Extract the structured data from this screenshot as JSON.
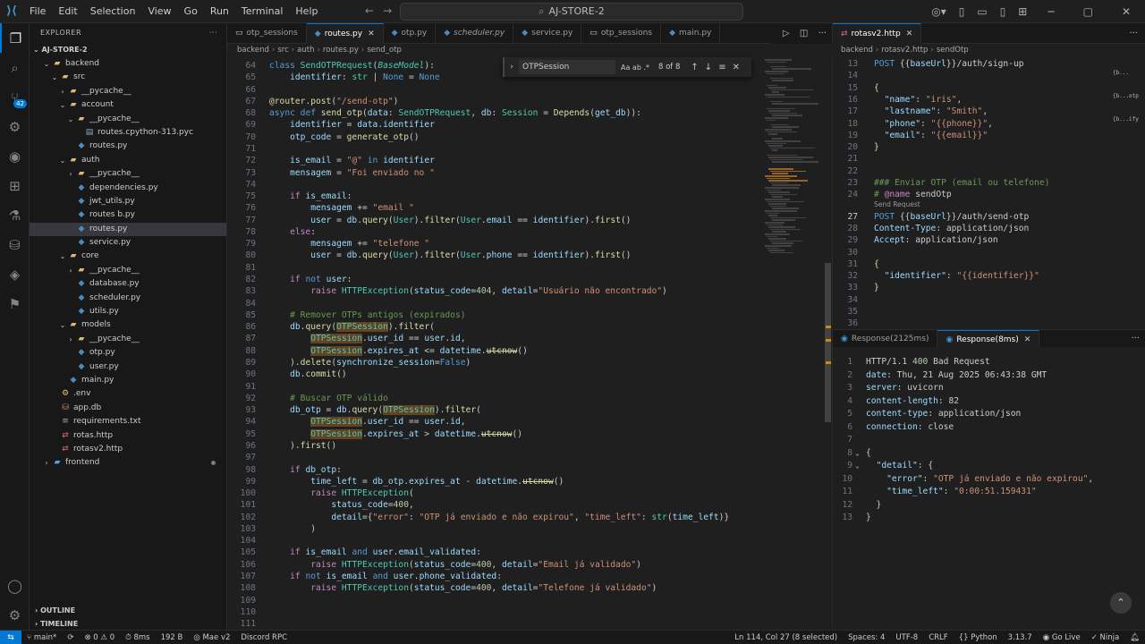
{
  "titlebar": {
    "menu": [
      "File",
      "Edit",
      "Selection",
      "View",
      "Go",
      "Run",
      "Terminal",
      "Help"
    ],
    "search_text": "AJ-STORE-2"
  },
  "activity": {
    "scm_badge": "42"
  },
  "sidebar": {
    "title": "EXPLORER",
    "root": "AJ-STORE-2",
    "tree": [
      {
        "label": "backend",
        "depth": 0,
        "kind": "folder",
        "open": true
      },
      {
        "label": "src",
        "depth": 1,
        "kind": "folder",
        "open": true
      },
      {
        "label": "__pycache__",
        "depth": 2,
        "kind": "folder",
        "open": false
      },
      {
        "label": "account",
        "depth": 2,
        "kind": "folder",
        "open": true
      },
      {
        "label": "__pycache__",
        "depth": 3,
        "kind": "folder",
        "open": true
      },
      {
        "label": "routes.cpython-313.pyc",
        "depth": 4,
        "kind": "file"
      },
      {
        "label": "routes.py",
        "depth": 3,
        "kind": "py"
      },
      {
        "label": "auth",
        "depth": 2,
        "kind": "folder",
        "open": true
      },
      {
        "label": "__pycache__",
        "depth": 3,
        "kind": "folder",
        "open": false
      },
      {
        "label": "dependencies.py",
        "depth": 3,
        "kind": "py"
      },
      {
        "label": "jwt_utils.py",
        "depth": 3,
        "kind": "py"
      },
      {
        "label": "routes b.py",
        "depth": 3,
        "kind": "py"
      },
      {
        "label": "routes.py",
        "depth": 3,
        "kind": "py",
        "selected": true
      },
      {
        "label": "service.py",
        "depth": 3,
        "kind": "py"
      },
      {
        "label": "core",
        "depth": 2,
        "kind": "folder",
        "open": true
      },
      {
        "label": "__pycache__",
        "depth": 3,
        "kind": "folder",
        "open": false
      },
      {
        "label": "database.py",
        "depth": 3,
        "kind": "py"
      },
      {
        "label": "scheduler.py",
        "depth": 3,
        "kind": "py"
      },
      {
        "label": "utils.py",
        "depth": 3,
        "kind": "py"
      },
      {
        "label": "models",
        "depth": 2,
        "kind": "folder",
        "open": true
      },
      {
        "label": "__pycache__",
        "depth": 3,
        "kind": "folder",
        "open": false
      },
      {
        "label": "otp.py",
        "depth": 3,
        "kind": "py"
      },
      {
        "label": "user.py",
        "depth": 3,
        "kind": "py"
      },
      {
        "label": "main.py",
        "depth": 2,
        "kind": "py"
      },
      {
        "label": ".env",
        "depth": 1,
        "kind": "env"
      },
      {
        "label": "app.db",
        "depth": 1,
        "kind": "db"
      },
      {
        "label": "requirements.txt",
        "depth": 1,
        "kind": "txt"
      },
      {
        "label": "rotas.http",
        "depth": 1,
        "kind": "http"
      },
      {
        "label": "rotasv2.http",
        "depth": 1,
        "kind": "http"
      },
      {
        "label": "frontend",
        "depth": 0,
        "kind": "fe",
        "open": false,
        "modified": true
      }
    ],
    "outline": "OUTLINE",
    "timeline": "TIMELINE"
  },
  "editor1": {
    "tabs": [
      {
        "label": "otp_sessions",
        "icon": "sc"
      },
      {
        "label": "routes.py",
        "icon": "py",
        "active": true
      },
      {
        "label": "otp.py",
        "icon": "py"
      },
      {
        "label": "scheduler.py",
        "icon": "py",
        "italic": true
      },
      {
        "label": "service.py",
        "icon": "py"
      },
      {
        "label": "otp_sessions",
        "icon": "sc"
      },
      {
        "label": "main.py",
        "icon": "py"
      }
    ],
    "breadcrumb": [
      "backend",
      "src",
      "auth",
      "routes.py",
      "send_otp"
    ],
    "find": {
      "query": "OTPSession",
      "opts": "Aa  ab  .*",
      "count": "8 of 8"
    },
    "lines": [
      {
        "n": "64",
        "h": "<span class=\"k\">class</span> <span class=\"t\">SendOTPRequest</span>(<span class=\"t\" style=\"font-style:italic\">BaseModel</span>):"
      },
      {
        "n": "65",
        "h": "    <span class=\"v\">identifier</span>: <span class=\"t\">str</span> | <span class=\"k\">None</span> = <span class=\"k\">None</span>"
      },
      {
        "n": "66",
        "h": ""
      },
      {
        "n": "67",
        "h": "<span class=\"f\">@router</span>.<span class=\"f\">post</span>(<span class=\"s\">\"/send-otp\"</span>)"
      },
      {
        "n": "68",
        "h": "<span class=\"k\">async</span> <span class=\"k\">def</span> <span class=\"f\">send_otp</span>(<span class=\"v\">data</span>: <span class=\"t\">SendOTPRequest</span>, <span class=\"v\">db</span>: <span class=\"t\">Session</span> = <span class=\"f\">Depends</span>(<span class=\"v\">get_db</span>)):"
      },
      {
        "n": "69",
        "h": "    <span class=\"v\">identifier</span> = <span class=\"v\">data</span>.<span class=\"v\">identifier</span>"
      },
      {
        "n": "70",
        "h": "    <span class=\"v\">otp_code</span> = <span class=\"f\">generate_otp</span>()"
      },
      {
        "n": "71",
        "h": ""
      },
      {
        "n": "72",
        "h": "    <span class=\"v\">is_email</span> = <span class=\"s\">\"@\"</span> <span class=\"k\">in</span> <span class=\"v\">identifier</span>"
      },
      {
        "n": "73",
        "h": "    <span class=\"v\">mensagem</span> = <span class=\"s\">\"Foi enviado no \"</span>"
      },
      {
        "n": "74",
        "h": ""
      },
      {
        "n": "75",
        "h": "    <span class=\"kw\">if</span> <span class=\"v\">is_email</span>:"
      },
      {
        "n": "76",
        "h": "        <span class=\"v\">mensagem</span> += <span class=\"s\">\"email \"</span>"
      },
      {
        "n": "77",
        "h": "        <span class=\"v\">user</span> = <span class=\"v\">db</span>.<span class=\"f\">query</span>(<span class=\"t\">User</span>).<span class=\"f\">filter</span>(<span class=\"t\">User</span>.<span class=\"v\">email</span> == <span class=\"v\">identifier</span>).<span class=\"f\">first</span>()"
      },
      {
        "n": "78",
        "h": "    <span class=\"kw\">else</span>:"
      },
      {
        "n": "79",
        "h": "        <span class=\"v\">mensagem</span> += <span class=\"s\">\"telefone \"</span>"
      },
      {
        "n": "80",
        "h": "        <span class=\"v\">user</span> = <span class=\"v\">db</span>.<span class=\"f\">query</span>(<span class=\"t\">User</span>).<span class=\"f\">filter</span>(<span class=\"t\">User</span>.<span class=\"v\">phone</span> == <span class=\"v\">identifier</span>).<span class=\"f\">first</span>()"
      },
      {
        "n": "81",
        "h": ""
      },
      {
        "n": "82",
        "h": "    <span class=\"kw\">if</span> <span class=\"k\">not</span> <span class=\"v\">user</span>:"
      },
      {
        "n": "83",
        "h": "        <span class=\"kw\">raise</span> <span class=\"t\">HTTPException</span>(<span class=\"v\">status_code</span>=<span class=\"n\">404</span>, <span class=\"v\">detail</span>=<span class=\"s\">\"Usuário não encontrado\"</span>)"
      },
      {
        "n": "84",
        "h": ""
      },
      {
        "n": "85",
        "h": "    <span class=\"c\"># Remover OTPs antigos (expirados)</span>"
      },
      {
        "n": "86",
        "h": "    <span class=\"v\">db</span>.<span class=\"f\">query</span>(<span class=\"hl\">OTPSession</span>).<span class=\"f\">filter</span>("
      },
      {
        "n": "87",
        "h": "        <span class=\"hl\">OTPSession</span>.<span class=\"v\">user_id</span> == <span class=\"v\">user</span>.<span class=\"v\">id</span>,"
      },
      {
        "n": "88",
        "h": "        <span class=\"hl\">OTPSession</span>.<span class=\"v\">expires_at</span> <= <span class=\"v\">datetime</span>.<span class=\"f strike\">utcnow</span>()"
      },
      {
        "n": "89",
        "h": "    ).<span class=\"f\">delete</span>(<span class=\"v\">synchronize_session</span>=<span class=\"k\">False</span>)"
      },
      {
        "n": "90",
        "h": "    <span class=\"v\">db</span>.<span class=\"f\">commit</span>()"
      },
      {
        "n": "91",
        "h": ""
      },
      {
        "n": "92",
        "h": "    <span class=\"c\"># Buscar OTP válido</span>"
      },
      {
        "n": "93",
        "h": "    <span class=\"v\">db_otp</span> = <span class=\"v\">db</span>.<span class=\"f\">query</span>(<span class=\"hl\">OTPSession</span>).<span class=\"f\">filter</span>("
      },
      {
        "n": "94",
        "h": "        <span class=\"hl\">OTPSession</span>.<span class=\"v\">user_id</span> == <span class=\"v\">user</span>.<span class=\"v\">id</span>,"
      },
      {
        "n": "95",
        "h": "        <span class=\"hl\">OTPSession</span>.<span class=\"v\">expires_at</span> > <span class=\"v\">datetime</span>.<span class=\"f strike\">utcnow</span>()"
      },
      {
        "n": "96",
        "h": "    ).<span class=\"f\">first</span>()"
      },
      {
        "n": "97",
        "h": ""
      },
      {
        "n": "98",
        "h": "    <span class=\"kw\">if</span> <span class=\"v\">db_otp</span>:"
      },
      {
        "n": "99",
        "h": "        <span class=\"v\">time_left</span> = <span class=\"v\">db_otp</span>.<span class=\"v\">expires_at</span> - <span class=\"v\">datetime</span>.<span class=\"f strike\">utcnow</span>()"
      },
      {
        "n": "100",
        "h": "        <span class=\"kw\">raise</span> <span class=\"t\">HTTPException</span>("
      },
      {
        "n": "101",
        "h": "            <span class=\"v\">status_code</span>=<span class=\"n\">400</span>,"
      },
      {
        "n": "102",
        "h": "            <span class=\"v\">detail</span>={<span class=\"s\">\"error\"</span>: <span class=\"s\">\"OTP já enviado e não expirou\"</span>, <span class=\"s\">\"time_left\"</span>: <span class=\"t\">str</span>(<span class=\"v\">time_left</span>)}"
      },
      {
        "n": "103",
        "h": "        )"
      },
      {
        "n": "104",
        "h": ""
      },
      {
        "n": "105",
        "h": "    <span class=\"kw\">if</span> <span class=\"v\">is_email</span> <span class=\"k\">and</span> <span class=\"v\">user</span>.<span class=\"v\">email_validated</span>:"
      },
      {
        "n": "106",
        "h": "        <span class=\"kw\">raise</span> <span class=\"t\">HTTPException</span>(<span class=\"v\">status_code</span>=<span class=\"n\">400</span>, <span class=\"v\">detail</span>=<span class=\"s\">\"Email já validado\"</span>)"
      },
      {
        "n": "107",
        "h": "    <span class=\"kw\">if</span> <span class=\"k\">not</span> <span class=\"v\">is_email</span> <span class=\"k\">and</span> <span class=\"v\">user</span>.<span class=\"v\">phone_validated</span>:"
      },
      {
        "n": "108",
        "h": "        <span class=\"kw\">raise</span> <span class=\"t\">HTTPException</span>(<span class=\"v\">status_code</span>=<span class=\"n\">400</span>, <span class=\"v\">detail</span>=<span class=\"s\">\"Telefone já validado\"</span>)"
      },
      {
        "n": "109",
        "h": ""
      },
      {
        "n": "110",
        "h": ""
      },
      {
        "n": "111",
        "h": ""
      }
    ]
  },
  "editor2": {
    "tab": "rotasv2.http",
    "breadcrumb": [
      "backend",
      "rotasv2.http",
      "sendOtp"
    ],
    "codelens": "Send Request",
    "lines": [
      {
        "n": "13",
        "h": "<span class=\"hk\">POST</span> <span class=\"hj\">{{</span><span class=\"hv\">baseUrl</span><span class=\"hj\">}}/auth/sign-up</span>"
      },
      {
        "n": "14",
        "h": ""
      },
      {
        "n": "15",
        "h": "<span class=\"f\">{</span>"
      },
      {
        "n": "16",
        "h": "  <span class=\"hv\">\"name\"</span>: <span class=\"hs\">\"iris\"</span>,"
      },
      {
        "n": "17",
        "h": "  <span class=\"hv\">\"lastname\"</span>: <span class=\"hs\">\"Smith\"</span>,"
      },
      {
        "n": "18",
        "h": "  <span class=\"hv\">\"phone\"</span>: <span class=\"hs\">\"{{phone}}\"</span>,"
      },
      {
        "n": "19",
        "h": "  <span class=\"hv\">\"email\"</span>: <span class=\"hs\">\"{{email}}\"</span>"
      },
      {
        "n": "20",
        "h": "<span class=\"f\">}</span>"
      },
      {
        "n": "21",
        "h": ""
      },
      {
        "n": "22",
        "h": ""
      },
      {
        "n": "23",
        "h": "<span class=\"hc\">### Enviar OTP (email ou telefone)</span>"
      },
      {
        "n": "24",
        "h": "<span class=\"hc\"># </span><span class=\"hm\">@name</span> <span class=\"hj\">sendOtp</span>"
      },
      {
        "n": "27",
        "h": "<span class=\"hk\">POST</span> <span class=\"hj\">{{</span><span class=\"hv\">baseUrl</span><span class=\"hj\">}}/auth/send-otp</span>"
      },
      {
        "n": "28",
        "h": "<span class=\"hv\">Content-Type</span>: <span class=\"hj\">application/json</span>"
      },
      {
        "n": "29",
        "h": "<span class=\"hv\">Accept</span>: <span class=\"hj\">application/json</span>"
      },
      {
        "n": "30",
        "h": ""
      },
      {
        "n": "31",
        "h": "<span class=\"f\">{</span>"
      },
      {
        "n": "32",
        "h": "  <span class=\"hv\">\"identifier\"</span>: <span class=\"hs\">\"{{identifier}}\"</span>"
      },
      {
        "n": "33",
        "h": "<span class=\"f\">}</span>"
      },
      {
        "n": "34",
        "h": ""
      },
      {
        "n": "35",
        "h": ""
      },
      {
        "n": "36",
        "h": ""
      }
    ],
    "minimap": [
      "{b...",
      "{b...otp",
      "{b...ify"
    ]
  },
  "responses": {
    "tabs": [
      {
        "label": "Response(2125ms)"
      },
      {
        "label": "Response(8ms)",
        "active": true
      }
    ],
    "lines": [
      {
        "n": "1",
        "h": "<span class=\"hj\">HTTP/1.1 </span><span class=\"n\">400</span><span class=\"hj\"> Bad Request</span>"
      },
      {
        "n": "2",
        "h": "<span class=\"hv\">date</span>: <span class=\"hj\">Thu, 21 Aug 2025 06:43:38 GMT</span>"
      },
      {
        "n": "3",
        "h": "<span class=\"hv\">server</span>: <span class=\"hj\">uvicorn</span>"
      },
      {
        "n": "4",
        "h": "<span class=\"hv\">content-length</span>: <span class=\"hj\">82</span>"
      },
      {
        "n": "5",
        "h": "<span class=\"hv\">content-type</span>: <span class=\"hj\">application/json</span>"
      },
      {
        "n": "6",
        "h": "<span class=\"hv\">connection</span>: <span class=\"hj\">close</span>"
      },
      {
        "n": "7",
        "h": ""
      },
      {
        "n": "8",
        "h": "<span class=\"hj\">{</span>",
        "fold": true
      },
      {
        "n": "9",
        "h": "  <span class=\"hv\">\"detail\"</span>: {",
        "fold": true
      },
      {
        "n": "10",
        "h": "    <span class=\"hv\">\"error\"</span>: <span class=\"hs\">\"OTP já enviado e não expirou\"</span>,"
      },
      {
        "n": "11",
        "h": "    <span class=\"hv\">\"time_left\"</span>: <span class=\"hs\">\"0:00:51.159431\"</span>"
      },
      {
        "n": "12",
        "h": "  }"
      },
      {
        "n": "13",
        "h": "}"
      }
    ]
  },
  "statusbar": {
    "branch": "main*",
    "sync": "⟳",
    "problems": "⊗ 0 ⚠ 0",
    "time": "8ms",
    "size": "192 B",
    "user": "Mae v2",
    "discord": "Discord RPC",
    "cursor": "Ln 114, Col 27 (8 selected)",
    "spaces": "Spaces: 4",
    "encoding": "UTF-8",
    "eol": "CRLF",
    "lang": "Python",
    "version": "3.13.7",
    "golive": "Go Live",
    "ninja": "Ninja"
  }
}
